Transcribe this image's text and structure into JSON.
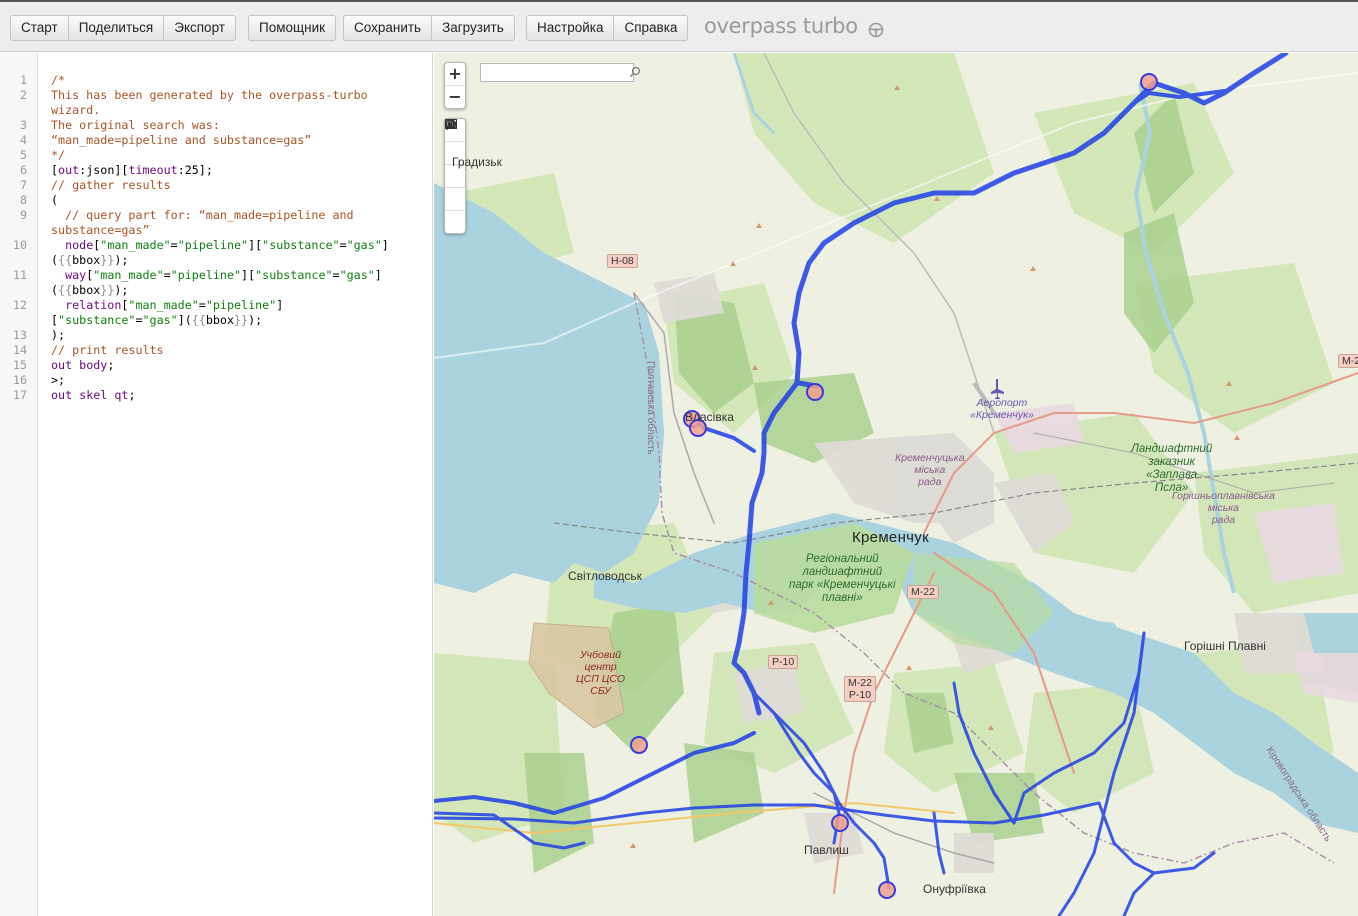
{
  "toolbar": {
    "group1": [
      "Старт",
      "Поделиться",
      "Экспорт"
    ],
    "group2": [
      "Помощник"
    ],
    "group3": [
      "Сохранить",
      "Загрузить"
    ],
    "group4": [
      "Настройка",
      "Справка"
    ],
    "brand": "overpass turbo"
  },
  "editor": {
    "line_numbers": [
      "1",
      "2",
      "",
      "3",
      "4",
      "5",
      "6",
      "7",
      "8",
      "9",
      "",
      "10",
      "",
      "11",
      "",
      "12",
      "",
      "13",
      "14",
      "15",
      "16",
      "17"
    ],
    "lines": [
      "/*",
      "This has been generated by the overpass-turbo",
      "wizard.",
      "The original search was:",
      "“man_made=pipeline and substance=gas”",
      "*/",
      "[out:json][timeout:25];",
      "// gather results",
      "(",
      "  // query part for: “man_made=pipeline and",
      "substance=gas”",
      "  node[\"man_made\"=\"pipeline\"][\"substance\"=\"gas\"]",
      "({{bbox}});",
      "  way[\"man_made\"=\"pipeline\"][\"substance\"=\"gas\"]",
      "({{bbox}});",
      "  relation[\"man_made\"=\"pipeline\"]",
      "[\"substance\"=\"gas\"]({{bbox}});",
      ");",
      "// print results",
      "out body;",
      ">;",
      "out skel qt;"
    ]
  },
  "map": {
    "zoom_in": "+",
    "zoom_out": "−",
    "search_placeholder": "",
    "labels": {
      "hradyzk": "Градизьк",
      "vlasivka": "Власівка",
      "svitlovodsk": "Світловодськ",
      "kremenchuk": "Кременчук",
      "park": [
        "Регіональний",
        "ландшафтний",
        "парк «Кременчуцькі",
        "плавні»"
      ],
      "airport": [
        "Аеропорт",
        "«Кременчук»"
      ],
      "city_council": [
        "Кременчуцька",
        "міська",
        "рада"
      ],
      "reserve": [
        "Ландшафтний",
        "заказник",
        "«Заплава",
        "Псла»"
      ],
      "horishni_council": [
        "Горішньоплавнівська",
        "міська",
        "рада"
      ],
      "horishni": "Горішні Плавні",
      "training": [
        "Учбовий",
        "центр",
        "ЦСП ЦСО",
        "СБУ"
      ],
      "pavlysh": "Павлиш",
      "onufriivka": "Онуфріївка",
      "poltava_oblast": "Полтавська область",
      "kirovohrad_oblast": "Кіровоградська область"
    },
    "roads": {
      "h08": "Н-08",
      "m22a": "М-22",
      "p10": "Р-10",
      "m22p10": [
        "М-22",
        "Р-10"
      ],
      "m22edge": "М-2"
    },
    "colors": {
      "pipeline": "#1f3fe6",
      "water": "#aad3df",
      "forest": "#add19e",
      "park": "#c8e6b0"
    }
  }
}
